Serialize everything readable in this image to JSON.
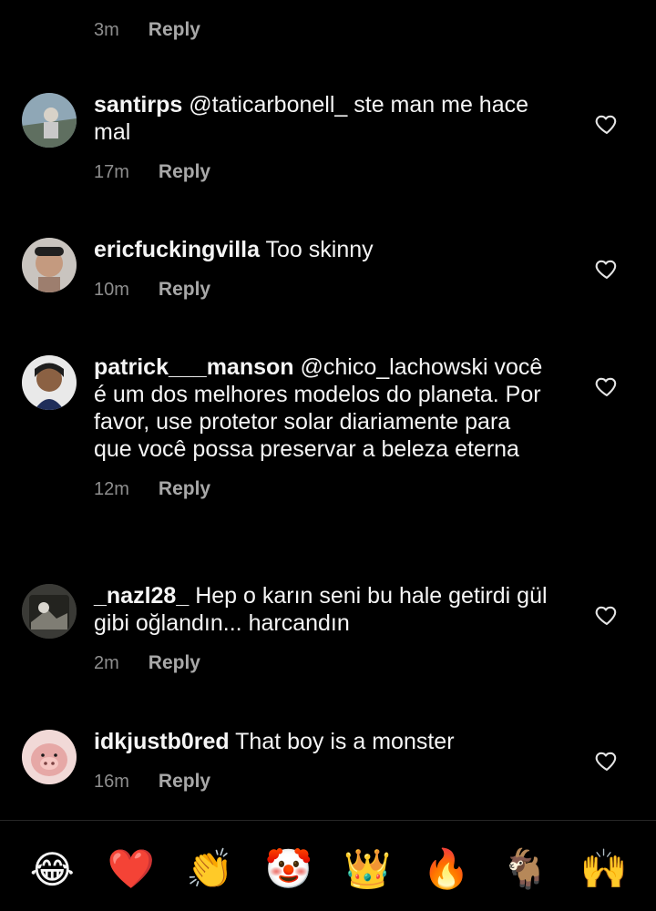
{
  "top": {
    "time": "3m",
    "reply": "Reply"
  },
  "comments": [
    {
      "username": "santirps",
      "text": " @taticarbonell_ ste man me hace mal",
      "time": "17m",
      "reply": "Reply",
      "avatar_colors": {
        "bg": "#8fa7b6",
        "fg": "#d8d2c8"
      }
    },
    {
      "username": "ericfuckingvilla",
      "text": " Too skinny",
      "time": "10m",
      "reply": "Reply",
      "avatar_colors": {
        "bg": "#c9c4bf",
        "fg": "#c49a7f"
      }
    },
    {
      "username": "patrick___manson",
      "text": " @chico_lachowski você é um dos melhores modelos do planeta. Por favor, use protetor solar diariamente para que você possa preservar a beleza eterna",
      "time": "12m",
      "reply": "Reply",
      "avatar_colors": {
        "bg": "#e9e9e9",
        "fg": "#8b6143"
      }
    },
    {
      "username": "_nazl28_",
      "text": " Hep o karın seni bu hale getirdi gül gibi oğlandın... harcandın",
      "time": "2m",
      "reply": "Reply",
      "avatar_colors": {
        "bg": "#3a3a36",
        "fg": "#d9d6cf"
      }
    },
    {
      "username": "idkjustb0red",
      "text": " That boy is a monster",
      "time": "16m",
      "reply": "Reply",
      "avatar_colors": {
        "bg": "#f1d9d7",
        "fg": "#e6a8a6"
      }
    }
  ],
  "emoji_bar": [
    {
      "name": "tears-of-joy",
      "char": "😂"
    },
    {
      "name": "red-heart",
      "char": "❤️"
    },
    {
      "name": "clapping-hands",
      "char": "👏"
    },
    {
      "name": "clown-face",
      "char": "🤡"
    },
    {
      "name": "crown",
      "char": "👑"
    },
    {
      "name": "fire",
      "char": "🔥"
    },
    {
      "name": "goat",
      "char": "🐐"
    },
    {
      "name": "raising-hands",
      "char": "🙌"
    }
  ],
  "colors": {
    "background": "#000000",
    "text": "#f5f5f5",
    "secondary": "#8e8e8e",
    "reply": "#a8a8a8"
  }
}
